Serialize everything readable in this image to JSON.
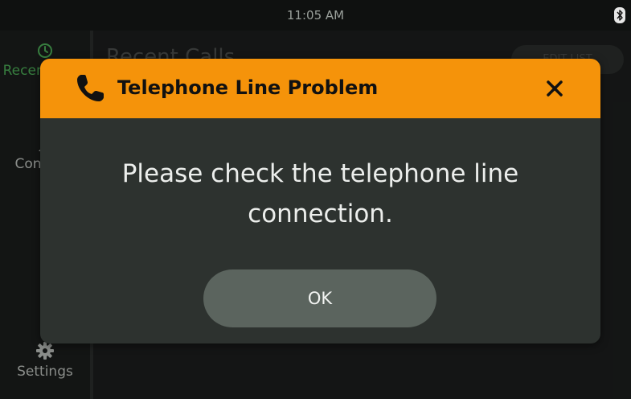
{
  "status_bar": {
    "time": "11:05 AM",
    "bluetooth_icon": "bluetooth-icon"
  },
  "sidebar": {
    "items": [
      {
        "label": "Recent Calls",
        "icon": "clock-icon",
        "active": true
      },
      {
        "label": "Contacts",
        "icon": "person-icon",
        "active": false
      },
      {
        "label": "Settings",
        "icon": "gear-icon",
        "active": false
      }
    ]
  },
  "main": {
    "title": "Recent Calls",
    "edit_button": "EDIT LIST"
  },
  "dialog": {
    "icon": "phone-icon",
    "title": "Telephone Line Problem",
    "close_icon": "close-icon",
    "message_line1": "Please check the telephone line",
    "message_line2": "connection.",
    "ok_label": "OK"
  },
  "colors": {
    "header_orange": "#f5930a",
    "dialog_bg": "#2d322f",
    "ok_button": "#5b645e",
    "accent_green": "#4aa855"
  }
}
